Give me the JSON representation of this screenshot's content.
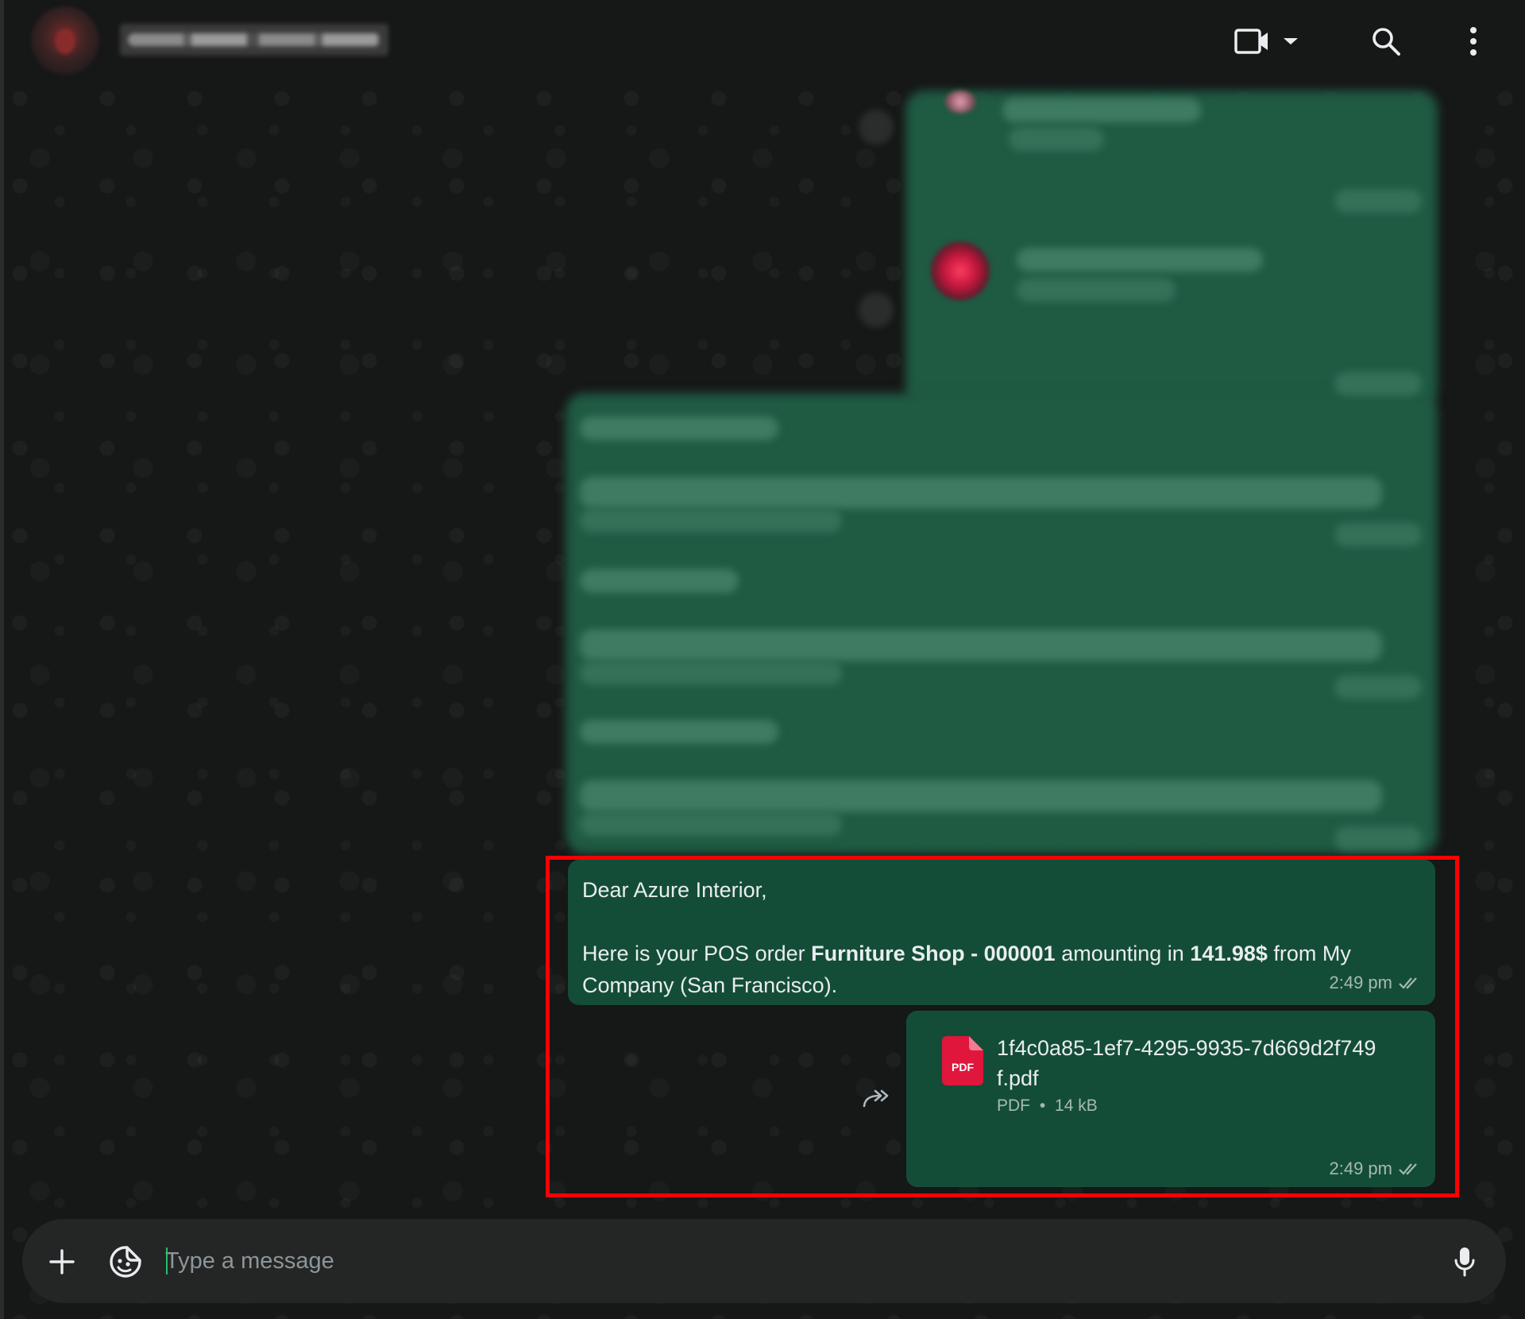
{
  "header": {
    "contact_name": "",
    "icons": {
      "video": "video-call-icon",
      "dropdown": "chevron-down-icon",
      "search": "search-icon",
      "menu": "more-vertical-icon"
    }
  },
  "messages": {
    "text_message": {
      "greeting": "Dear Azure Interior,",
      "body_prefix": "Here is your POS order ",
      "order_name": "Furniture Shop - 000001",
      "body_middle": " amounting in ",
      "amount": "141.98$",
      "body_suffix": " from My Company (San Francisco).",
      "time": "2:49 pm",
      "status_icon": "double-check-icon"
    },
    "file_message": {
      "icon_label": "PDF",
      "file_name": "1f4c0a85-1ef7-4295-9935-7d669d2f749f.pdf",
      "file_type": "PDF",
      "separator": "•",
      "file_size": "14 kB",
      "time": "2:49 pm",
      "status_icon": "double-check-icon",
      "forward_icon": "forward-icon"
    }
  },
  "composer": {
    "placeholder": "Type a message",
    "value": "",
    "icons": {
      "attach": "plus-icon",
      "sticker": "sticker-icon",
      "voice": "microphone-icon"
    }
  },
  "colors": {
    "background": "#161717",
    "outgoing_bubble": "#144d37",
    "text": "#e9edef",
    "muted_text": "#8d9598",
    "pdf_red": "#e0163d",
    "highlight": "#ff0000",
    "caret": "#21c063"
  }
}
